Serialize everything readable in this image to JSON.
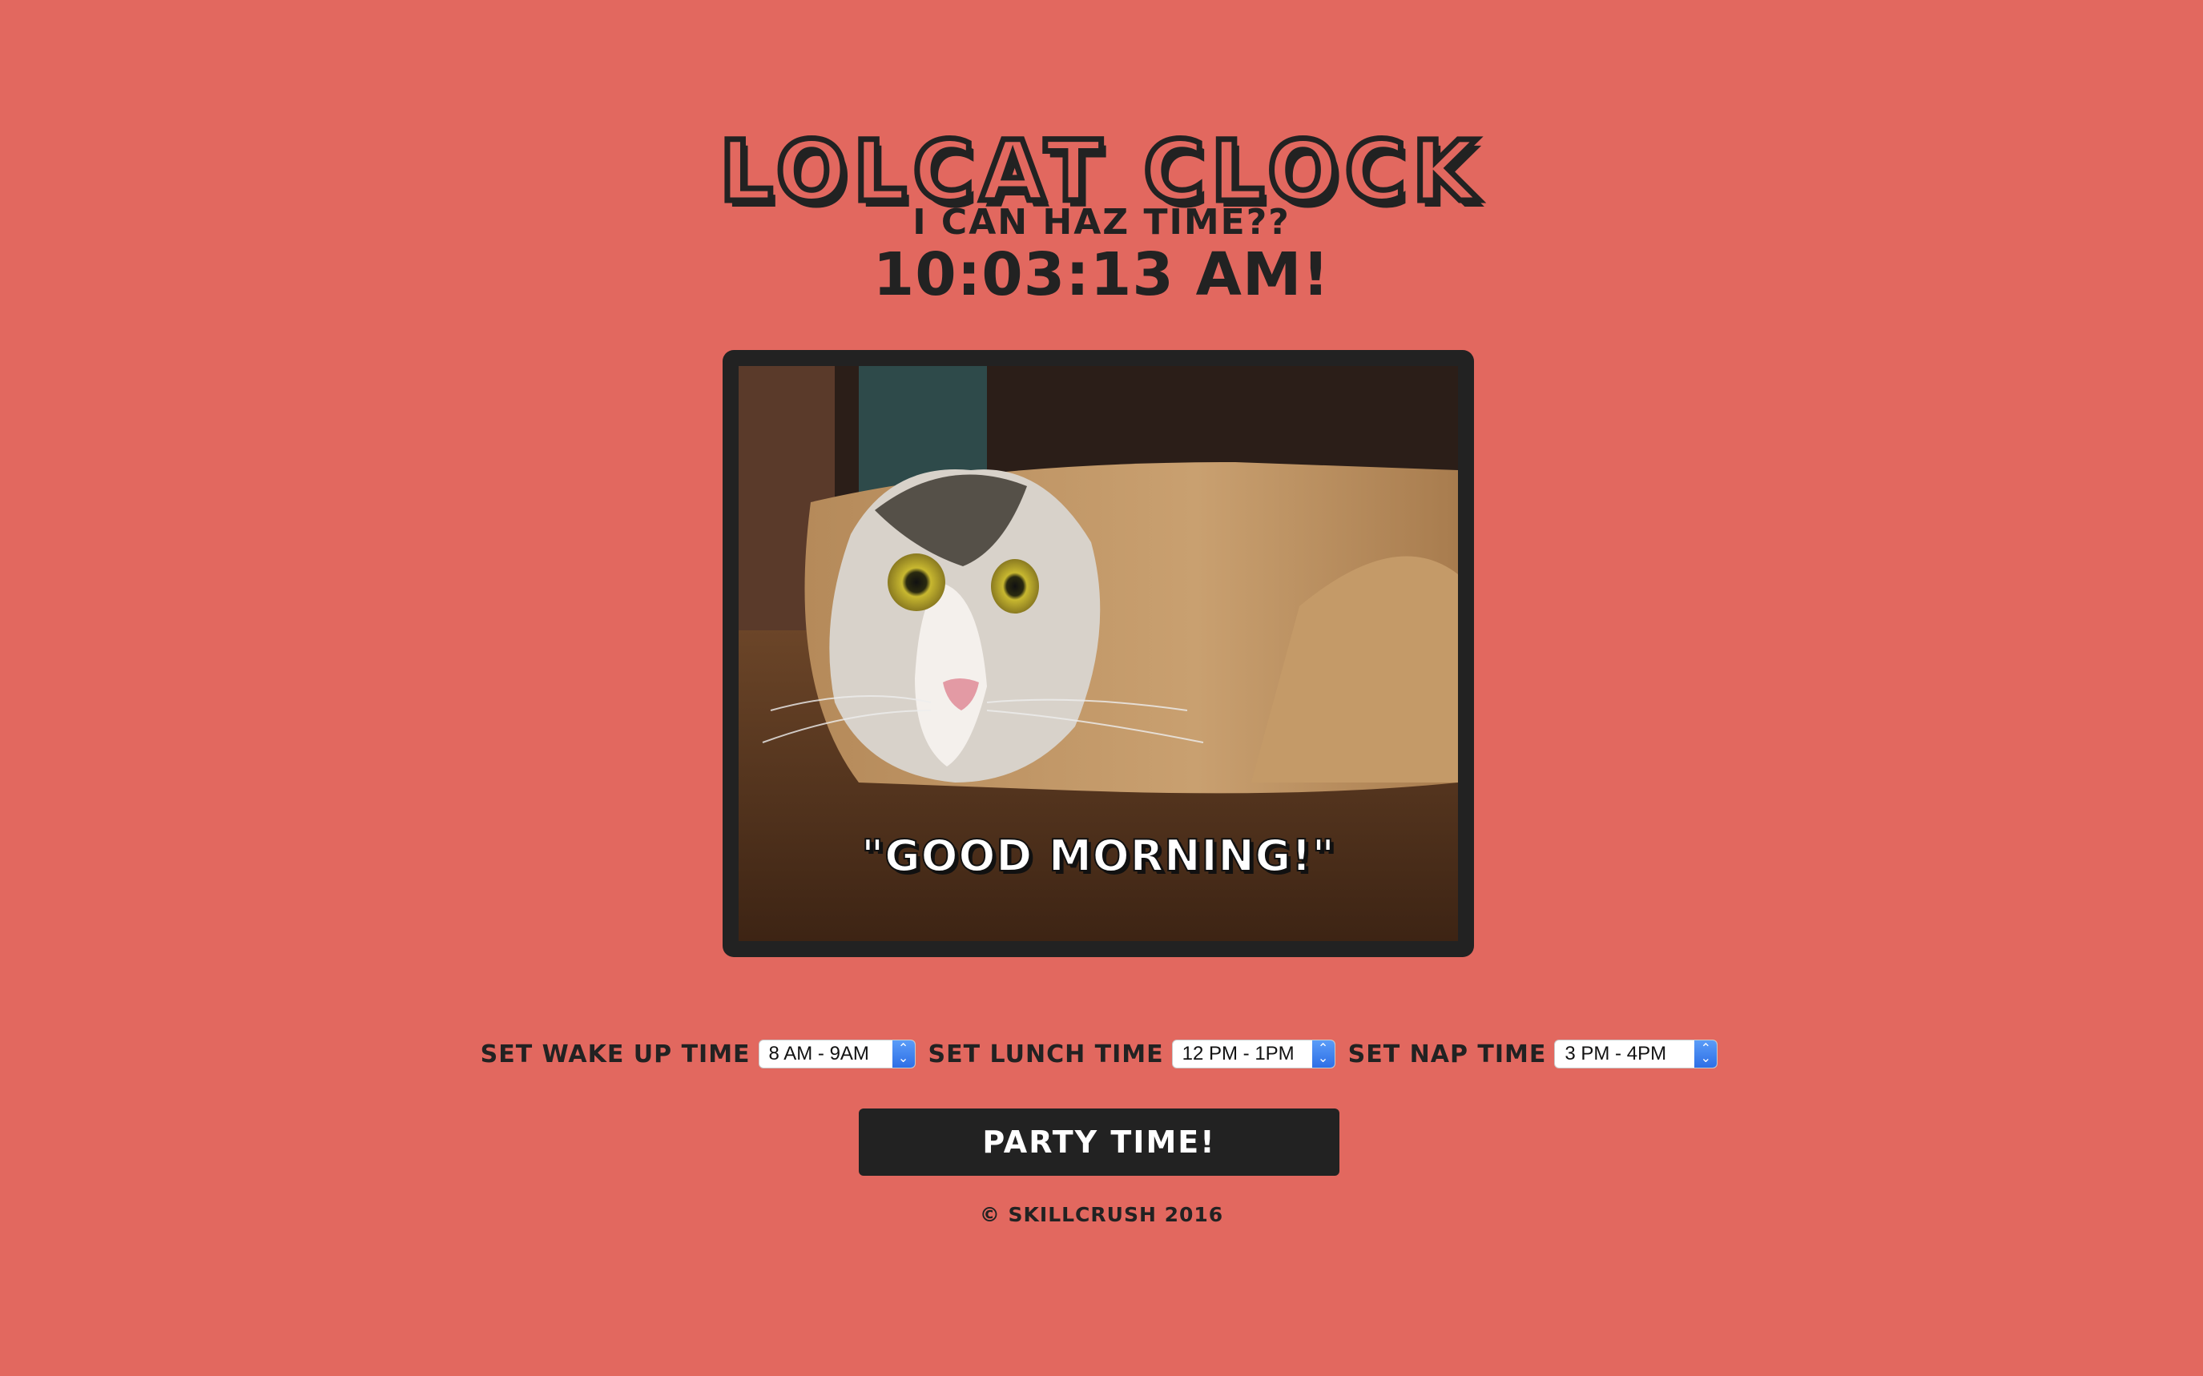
{
  "colors": {
    "background": "#e2685f",
    "dark": "#222222",
    "select_accent": "#2e6fe6"
  },
  "header": {
    "title": "LOLCAT CLOCK",
    "subtitle": "I CAN HAZ TIME??",
    "time": "10:03:13 AM!"
  },
  "image": {
    "icon": "cat-in-paper-roll-photo",
    "caption": "\"GOOD MORNING!\""
  },
  "controls": {
    "wake_label": "SET WAKE UP TIME",
    "wake_value": "8 AM - 9AM",
    "lunch_label": "SET LUNCH TIME",
    "lunch_value": "12 PM - 1PM",
    "nap_label": "SET NAP TIME",
    "nap_value": "3 PM - 4PM"
  },
  "party_button": "PARTY TIME!",
  "footer": "© SKILLCRUSH 2016"
}
